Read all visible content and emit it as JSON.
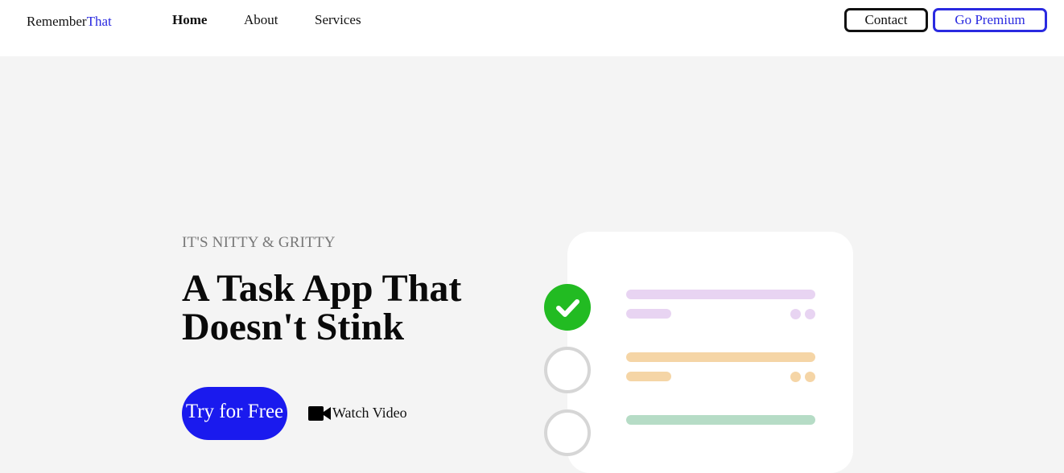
{
  "header": {
    "logo_main": "Remember",
    "logo_accent": "That",
    "nav": [
      "Home",
      "About",
      "Services"
    ],
    "contact_label": "Contact",
    "premium_label": "Go Premium"
  },
  "hero": {
    "eyebrow": "IT'S NITTY & GRITTY",
    "headline": "A Task App That Doesn't Stink",
    "cta_label": "Try for Free",
    "video_label": "Watch Video",
    "video_icon": "video-camera-icon"
  },
  "illustration": {
    "tasks": [
      {
        "state": "done",
        "color": "#e8d4f2"
      },
      {
        "state": "todo",
        "color": "#f5d5a6"
      },
      {
        "state": "todo",
        "color": "#b6dcc6"
      }
    ],
    "check_color": "#22bb22"
  },
  "colors": {
    "accent": "#2a2ae0",
    "cta": "#1a1aee",
    "background": "#f4f4f4"
  }
}
